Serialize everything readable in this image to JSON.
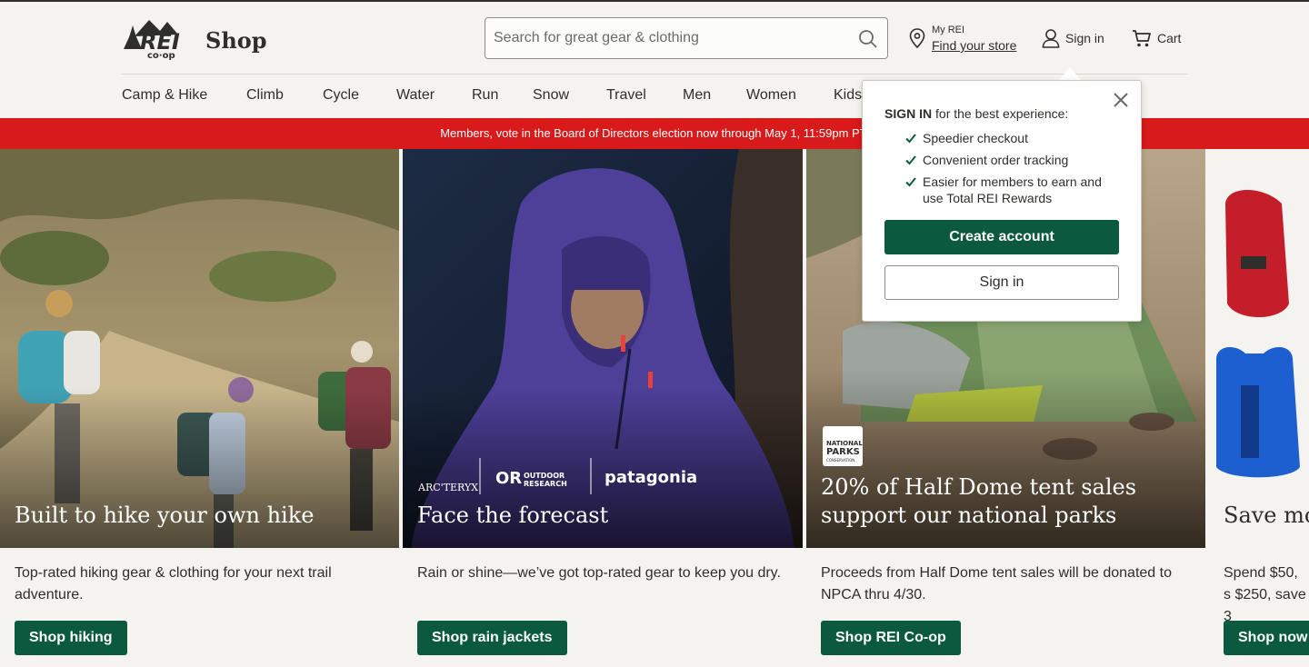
{
  "header": {
    "shop_label": "Shop",
    "search_placeholder": "Search for great gear & clothing",
    "store": {
      "top": "My REI",
      "link": "Find your store"
    },
    "signin_label": "Sign in",
    "cart_label": "Cart"
  },
  "nav": {
    "items": [
      "Camp & Hike",
      "Climb",
      "Cycle",
      "Water",
      "Run",
      "Snow",
      "Travel",
      "Men",
      "Women",
      "Kids"
    ]
  },
  "banner": {
    "text": "Members, vote in the Board of Directors election now through May 1, 11:59pm PT."
  },
  "cards": [
    {
      "title": "Built to hike your own hike",
      "description": "Top-rated hiking gear & clothing for your next trail adventure.",
      "button": "Shop hiking"
    },
    {
      "title": "Face the forecast",
      "description": "Rain or shine—we’ve got top-rated gear to keep you dry.",
      "button": "Shop rain jackets",
      "brands": [
        "ARC'TERYX",
        "OUTDOOR RESEARCH",
        "patagonia"
      ]
    },
    {
      "title_line1": "20% of Half Dome tent sales",
      "title_line2": "support our national parks",
      "description": "Proceeds from Half Dome tent sales will be donated to NPCA thru 4/30.",
      "button": "Shop REI Co-op",
      "badge": "NATIONAL PARKS CONSERVATION ASSOCIATION"
    },
    {
      "title": "Save mo",
      "description": "Spend $50, s $250, save 3",
      "button": "Shop now"
    }
  ],
  "popup": {
    "intro_bold": "SIGN IN",
    "intro_rest": " for the best experience:",
    "benefits": [
      "Speedier checkout",
      "Convenient order tracking",
      "Easier for members to earn and use Total REI Rewards"
    ],
    "create_label": "Create account",
    "signin_label": "Sign in"
  },
  "colors": {
    "brand_green": "#0b5a40",
    "banner_red": "#d81a1a",
    "background": "#f4f3ef"
  },
  "icons": [
    "rei-logo",
    "search-icon",
    "location-pin-icon",
    "user-icon",
    "cart-icon",
    "close-icon",
    "check-icon"
  ]
}
